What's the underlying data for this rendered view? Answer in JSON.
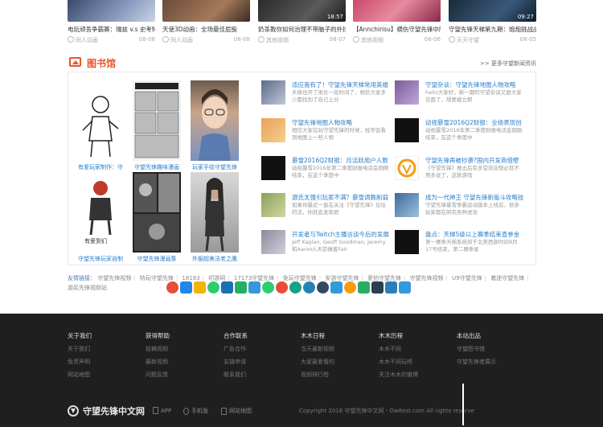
{
  "videos": [
    {
      "title": "电玩顽吾争霸赛：瑞兹 v.s 史考特",
      "source": "同人动画",
      "date": "08-08",
      "duration": ""
    },
    {
      "title": "天使3D动画：全场最佳屁股",
      "source": "同人动画",
      "date": "08-08",
      "duration": ""
    },
    {
      "title": "奶茶教你如何治理不带脑子的外挂",
      "source": "其他视频",
      "date": "08-07",
      "duration": "18:57"
    },
    {
      "title": "【Annchirisu】横伤守望先锋中所",
      "source": "其他视频",
      "date": "08-06",
      "duration": ""
    },
    {
      "title": "守望先锋天梯第九期：炮炮挑战战队",
      "source": "天天守望",
      "date": "08-05",
      "duration": "09:27"
    }
  ],
  "library": {
    "title": "图书馆",
    "more": ">> 更多守望新闻资讯",
    "books": [
      {
        "title": "有爱玩家制作：守"
      },
      {
        "title": "守望先锋趣味漫画"
      },
      {
        "title": "玩家手绘守望先锋"
      },
      {
        "title": "守望先锋玩家自制"
      },
      {
        "title": "守望先锋漫画集"
      },
      {
        "title": "外服超美法老之鹰"
      }
    ],
    "news": [
      {
        "title": "适应我有了！守望先锋天梯常用英雄",
        "desc": "天梯也开了很长一段时间了，相信大家多少都找到了自己上分"
      },
      {
        "title": "守望先锋地图人物攻略",
        "desc": "相信大家在玩守望先锋的时候，经常会看到地图上一些人物"
      },
      {
        "title": "暴雪2016Q2财报：月活跃用户人数",
        "desc": "动视暴雪2016年第二季度财报电话会刚刚结束，在这个季度中"
      },
      {
        "title": "源氏太强引玩家不满？暴雪调教削弱",
        "desc": "如果你最近一直在关注《守望先锋》论坛的话，你就会发现很"
      },
      {
        "title": "开发者与Twitch主播访谈今后的发展",
        "desc": "Jeff Kaplan, Geoff Goodman, Jeremy和Aaron/L天前做客Fair"
      },
      {
        "title": "守望杂谈：守望先锋地图人物攻略",
        "desc": "hello大家好，新一期的守望杂谈又跟大家见面了，想要被立即"
      },
      {
        "title": "动视暴雪2016Q2财报：业绩表现创",
        "desc": "动视暴雪2016年第二季度财报电话会刚刚结束，在这个季度中"
      },
      {
        "title": "守望先锋再被抄袭?国内开发商借壁",
        "desc": "《守望先锋》推出后有多受欢迎想必就不用多说了，这款游戏"
      },
      {
        "title": "成为一代神王 守望先锋新版斗攻略技",
        "desc": "守望先锋暴雪争霸运动版本上线后，很多玩家都在研究各种进攻"
      },
      {
        "title": "盘点：天梯5级以上赛季结束直参金",
        "desc": "第一赛季天梯系统将于北美西部时间8月17号结束，第二赛季星"
      }
    ]
  },
  "links": {
    "label": "友情链接：",
    "items": [
      "守望先锋视频",
      "特玩守望先锋",
      "18183",
      "叨游网",
      "17173守望先锋",
      "免玩守望先锋",
      "安游守望先锋",
      "爱拍守望先锋",
      "守望先锋视频",
      "U9守望先锋",
      "着迷守望先锋",
      "游民先锋视频站"
    ]
  },
  "share_icons": [
    "heart-icon",
    "qq-icon",
    "qzone-icon",
    "wechat-icon",
    "renren-icon",
    "douban-icon",
    "tencent-weibo-icon",
    "clover-icon",
    "weibo-icon",
    "pinterest-icon",
    "baidu-icon",
    "paw-icon",
    "mail-icon",
    "star-icon",
    "box-icon",
    "tumblr-icon",
    "copy-icon",
    "plus-icon"
  ],
  "footer": {
    "columns": [
      {
        "head": "关于我们",
        "items": [
          "关于我们",
          "免责声明",
          "网站地图"
        ]
      },
      {
        "head": "获得帮助",
        "items": [
          "投稿视频",
          "最新视频",
          "问题反馈"
        ]
      },
      {
        "head": "合作联系",
        "items": [
          "广告合作",
          "友链申请",
          "联系我们"
        ]
      },
      {
        "head": "木木日程",
        "items": [
          "当天最新视频",
          "大家最爱看的",
          "视频排行榜"
        ]
      },
      {
        "head": "木木历程",
        "items": [
          "木木不同",
          "木木不同玩吧",
          "关注木木的微博"
        ]
      },
      {
        "head": "本站出品",
        "items": [
          "守望图书馆",
          "守望先锋者展示"
        ]
      }
    ],
    "logo": "守望先锋中文网",
    "app": "APP",
    "mobile": "手机版",
    "sitemap": "网站地图",
    "copyright": "Copyright 2016 守望先锋中文网 - Ow8est.com All rights reserve"
  }
}
